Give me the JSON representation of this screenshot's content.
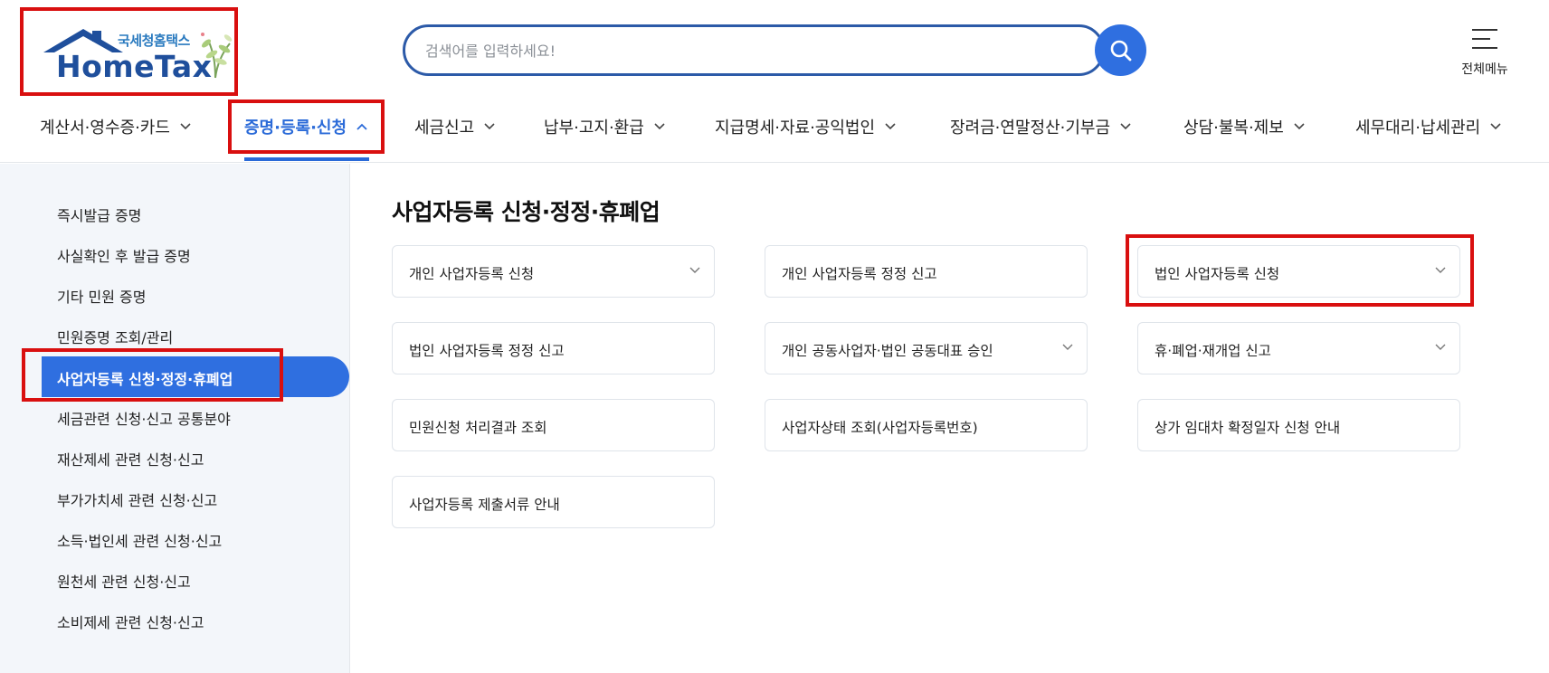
{
  "logo": {
    "sub": "국세청홈택스",
    "main": "HomeTax"
  },
  "search": {
    "placeholder": "검색어를 입력하세요!"
  },
  "allmenu": {
    "label": "전체메뉴"
  },
  "gnb": [
    {
      "label": "계산서·영수증·카드"
    },
    {
      "label": "증명·등록·신청"
    },
    {
      "label": "세금신고"
    },
    {
      "label": "납부·고지·환급"
    },
    {
      "label": "지급명세·자료·공익법인"
    },
    {
      "label": "장려금·연말정산·기부금"
    },
    {
      "label": "상담·불복·제보"
    },
    {
      "label": "세무대리·납세관리"
    }
  ],
  "sidebar": {
    "items": [
      "즉시발급 증명",
      "사실확인 후 발급 증명",
      "기타 민원 증명",
      "민원증명 조회/관리",
      "사업자등록 신청·정정·휴폐업",
      "세금관련 신청·신고 공통분야",
      "재산제세 관련 신청·신고",
      "부가가치세 관련 신청·신고",
      "소득·법인세 관련 신청·신고",
      "원천세 관련 신청·신고",
      "소비제세 관련 신청·신고"
    ]
  },
  "main": {
    "title": "사업자등록 신청·정정·휴폐업",
    "cards": [
      {
        "label": "개인 사업자등록 신청"
      },
      {
        "label": "개인 사업자등록 정정 신고"
      },
      {
        "label": "법인 사업자등록 신청"
      },
      {
        "label": "법인 사업자등록 정정 신고"
      },
      {
        "label": "개인 공동사업자·법인 공동대표 승인"
      },
      {
        "label": "휴·폐업·재개업 신고"
      },
      {
        "label": "민원신청 처리결과 조회"
      },
      {
        "label": "사업자상태 조회(사업자등록번호)"
      },
      {
        "label": "상가 임대차 확정일자 신청 안내"
      },
      {
        "label": "사업자등록 제출서류 안내"
      }
    ]
  },
  "colors": {
    "accent": "#2f6fe0",
    "highlight": "#d90f0f",
    "brand": "#1f4f9c"
  },
  "icons": {
    "search": "search-icon",
    "menu": "hamburger-icon",
    "chevron": "chevron-down-icon"
  }
}
